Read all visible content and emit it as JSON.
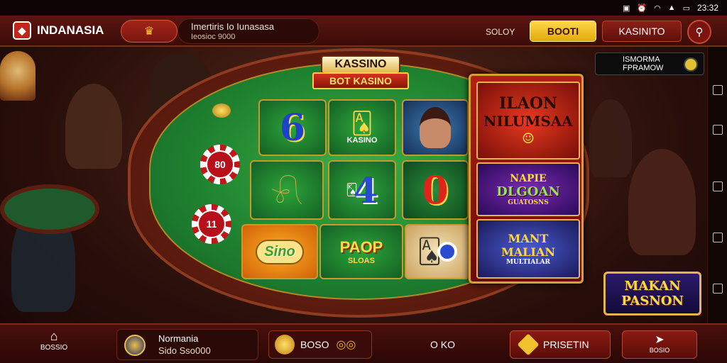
{
  "status_bar": {
    "time": "23:32"
  },
  "header": {
    "brand": "INDANASIA",
    "news_line1": "Imertiris Io Iunasasa",
    "news_line2": "Ieosioc 9000",
    "label": "SOLOY",
    "primary_button": "BOOTI",
    "secondary_button": "KASINITO"
  },
  "table": {
    "title_top": "KASSINO",
    "title_bottom": "BOT KASINO",
    "chip_left_top": "80",
    "chip_left_bottom": "11",
    "tiles": {
      "six": "6",
      "kasino": "KASINO",
      "four": "4",
      "zero": "0",
      "sino": "Sino",
      "paop": "PAOP",
      "paop_sub": "SLOAS"
    }
  },
  "toast": {
    "line1": "ISMORMA",
    "line2": "FPRAMOW"
  },
  "panel": {
    "card1_line1": "ILAON",
    "card1_line2": "NILUMSAA",
    "card2_line1": "NAPIE",
    "card2_line2": "DLGOAN",
    "card2_line3": "GUATOSNS",
    "card3_line1": "MANT",
    "card3_line2": "MALIAN",
    "card3_line3": "MULTIALAR"
  },
  "bonus_badge": {
    "line1": "MAKAN",
    "line2": "PASNON"
  },
  "bottom_bar": {
    "home_label": "BOSSIO",
    "profile_name": "Normania",
    "profile_value": "Sido Sso000",
    "bonus_label": "BOSO",
    "center_text": "O KO",
    "prise_label": "PRISETIN",
    "more_label": "BOSIO"
  },
  "colors": {
    "accent_gold": "#ffd84a",
    "brand_red": "#8a1a12",
    "felt_green": "#1f8230"
  }
}
